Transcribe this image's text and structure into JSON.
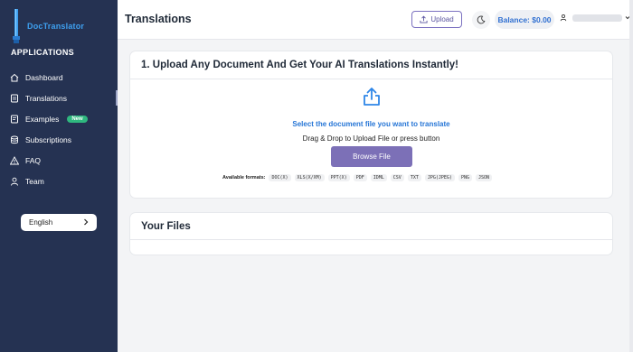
{
  "sidebar": {
    "brand": "DocTranslator",
    "section_heading": "APPLICATIONS",
    "items": [
      {
        "label": "Dashboard",
        "icon": "home-icon"
      },
      {
        "label": "Translations",
        "icon": "document-icon"
      },
      {
        "label": "Examples",
        "icon": "examples-icon",
        "badge": "New"
      },
      {
        "label": "Subscriptions",
        "icon": "stack-icon"
      },
      {
        "label": "FAQ",
        "icon": "warning-icon"
      },
      {
        "label": "Team",
        "icon": "user-icon"
      }
    ],
    "language": "English"
  },
  "header": {
    "title": "Translations",
    "upload_label": "Upload",
    "balance": "Balance: $0.00"
  },
  "upload_card": {
    "title": "1. Upload Any Document And Get Your AI Translations Instantly!",
    "select_text": "Select the document file you want to translate",
    "drag_text": "Drag & Drop to Upload File or press button",
    "browse_label": "Browse File",
    "formats_label": "Available formats:",
    "formats": [
      "DOC(X)",
      "XLS(X/XM)",
      "PPT(X)",
      "PDF",
      "IDML",
      "CSV",
      "TXT",
      "JPG(JPEG)",
      "PNG",
      "JSON"
    ]
  },
  "files_card": {
    "title": "Your Files"
  },
  "colors": {
    "sidebar_bg": "#253252",
    "brand_blue": "#3ea0f0",
    "button_purple": "#7c70b7",
    "link_blue": "#2575d6",
    "badge_green": "#2fb87f"
  }
}
